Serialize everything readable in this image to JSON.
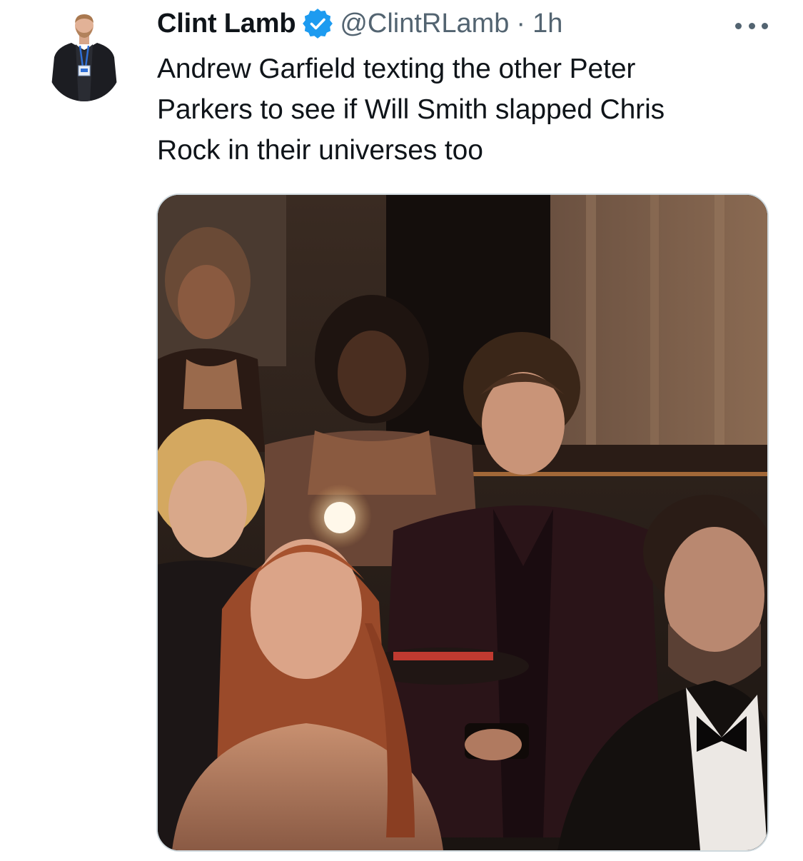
{
  "tweet": {
    "author": {
      "display_name": "Clint Lamb",
      "handle": "@ClintRLamb",
      "verified": true,
      "avatar_icon": "profile-photo"
    },
    "separator": "·",
    "timestamp": "1h",
    "more_icon": "more-options-icon",
    "text_lines": [
      "Andrew Garfield texting the other Peter",
      "Parkers to see if Will Smith slapped Chris",
      "Rock in their universes too"
    ],
    "media": {
      "type": "photo"
    }
  },
  "colors": {
    "text_primary": "#0f1419",
    "text_secondary": "#536471",
    "verified_blue": "#1d9bf0",
    "media_border": "#cfd9de"
  }
}
